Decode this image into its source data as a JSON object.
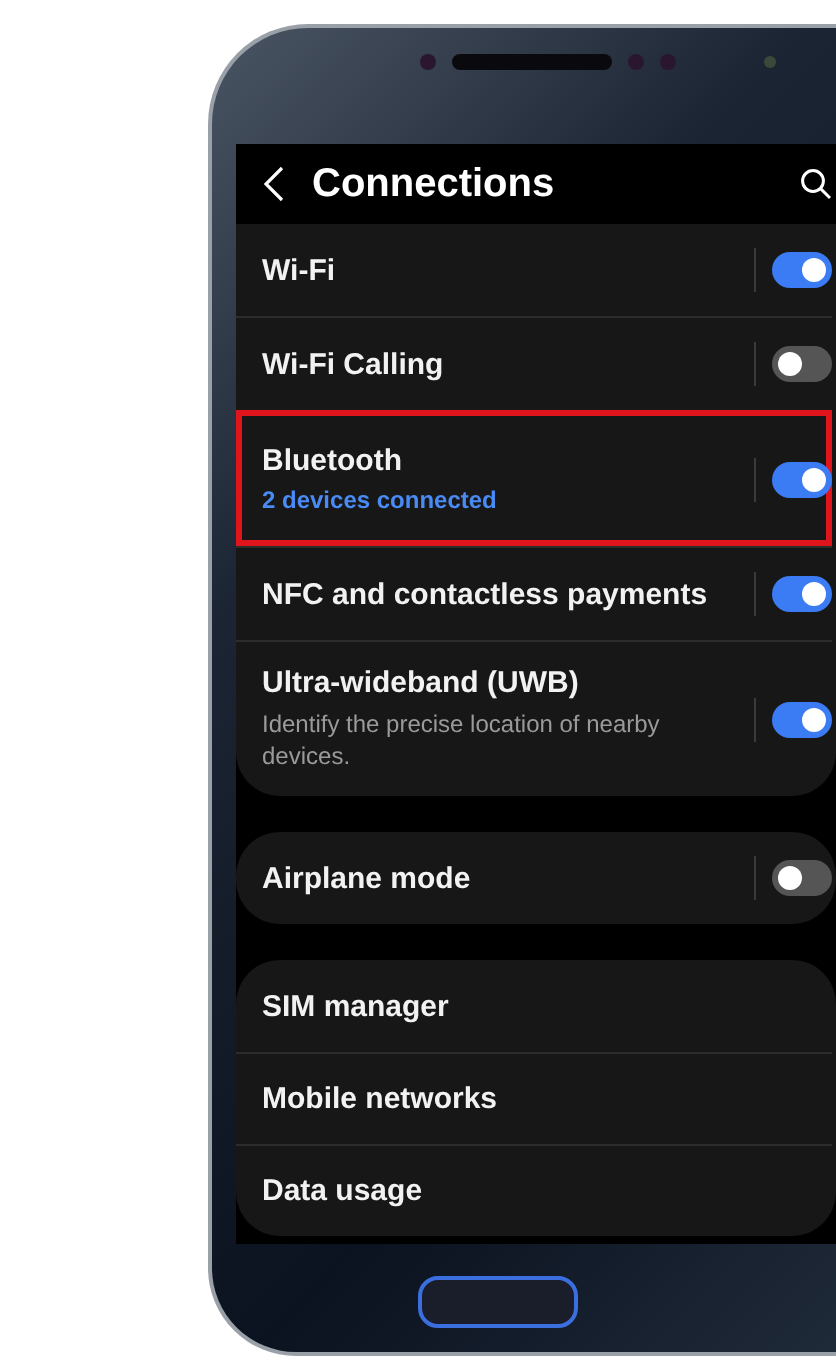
{
  "header": {
    "title": "Connections"
  },
  "groups": [
    {
      "clipped_top": true,
      "items": [
        {
          "kind": "toggle",
          "label": "Wi-Fi",
          "on": true,
          "highlighted": false
        },
        {
          "kind": "toggle",
          "label": "Wi-Fi Calling",
          "on": false,
          "highlighted": false
        },
        {
          "kind": "toggle",
          "label": "Bluetooth",
          "subtitle": {
            "kind": "status",
            "text": "2 devices connected"
          },
          "on": true,
          "highlighted": true
        },
        {
          "kind": "toggle",
          "label": "NFC and contactless payments",
          "on": true,
          "highlighted": false
        },
        {
          "kind": "toggle",
          "label": "Ultra-wideband (UWB)",
          "subtitle": {
            "kind": "description",
            "text": "Identify the precise location of nearby devices."
          },
          "on": true,
          "highlighted": false
        }
      ]
    },
    {
      "clipped_top": false,
      "items": [
        {
          "kind": "toggle",
          "label": "Airplane mode",
          "on": false,
          "highlighted": false
        }
      ]
    },
    {
      "clipped_top": false,
      "items": [
        {
          "kind": "link",
          "label": "SIM manager",
          "highlighted": false
        },
        {
          "kind": "link",
          "label": "Mobile networks",
          "highlighted": false
        },
        {
          "kind": "link",
          "label": "Data usage",
          "highlighted": false
        }
      ]
    }
  ]
}
